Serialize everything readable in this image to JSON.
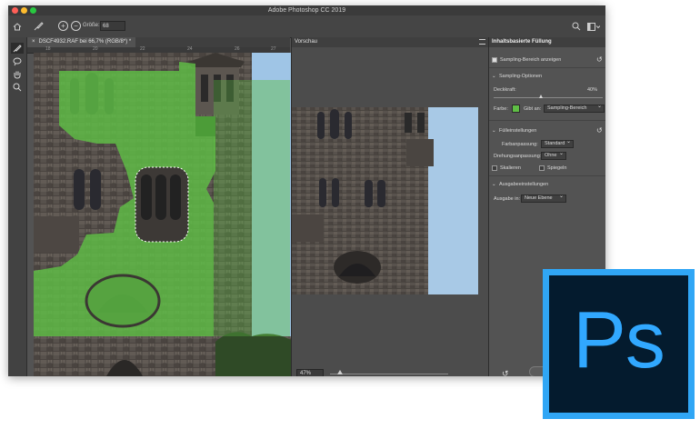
{
  "app": {
    "title": "Adobe Photoshop CC 2019"
  },
  "options_bar": {
    "size_label": "Größe:",
    "size_value": "68"
  },
  "document": {
    "tab_label": "DSCF4932.RAF bei 66,7% (RGB/8*) *"
  },
  "ruler": {
    "ticks": [
      "18",
      "20",
      "22",
      "24",
      "26",
      "27"
    ]
  },
  "preview": {
    "title": "Vorschau",
    "zoom_value": "47%"
  },
  "panel": {
    "title": "Inhaltsbasierte Füllung",
    "show_sampling_label": "Sampling-Bereich anzeigen",
    "show_sampling_checked": true,
    "sampling_options_header": "Sampling-Optionen",
    "opacity_label": "Deckkraft:",
    "opacity_value": "40%",
    "color_label": "Farbe:",
    "color_value": "#5fbe45",
    "indicates_label": "Gibt an:",
    "indicates_value": "Sampling-Bereich",
    "fill_settings_header": "Fülleinstellungen",
    "color_adapt_label": "Farbanpassung:",
    "color_adapt_value": "Standard",
    "rotation_adapt_label": "Drehungsanpassung:",
    "rotation_adapt_value": "Ohne",
    "scale_label": "Skalieren",
    "mirror_label": "Spiegeln",
    "output_settings_header": "Ausgabeeinstellungen",
    "output_label": "Ausgabe in:",
    "output_value": "Neue Ebene",
    "cancel_label": "Abbre"
  },
  "logo": {
    "text": "Ps"
  },
  "colors": {
    "logo_border": "#30a6f5",
    "logo_bg": "#041b2e",
    "logo_text": "#31a8ff",
    "overlay": "#5fbe45"
  }
}
